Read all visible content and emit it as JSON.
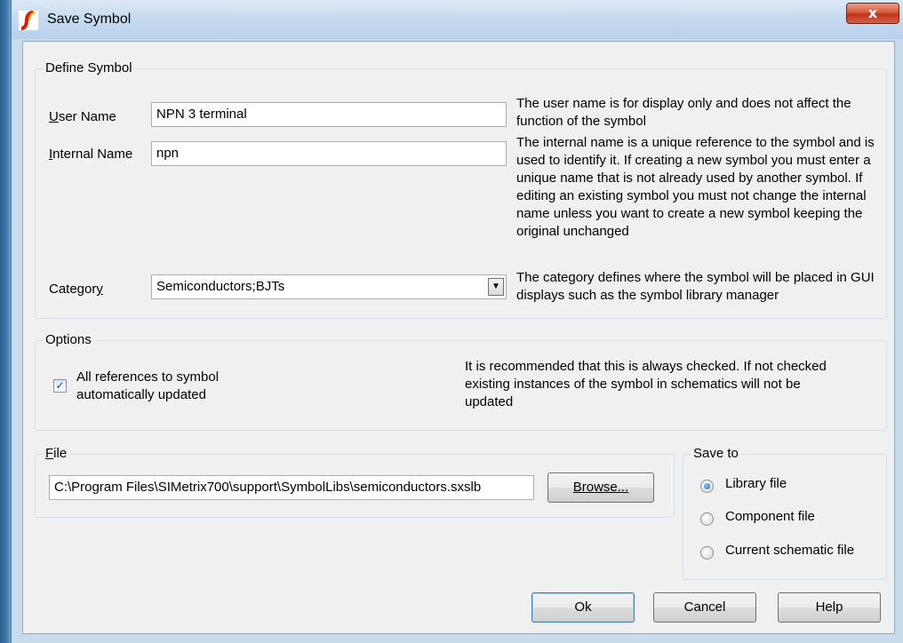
{
  "window": {
    "title": "Save Symbol",
    "close_label": "x"
  },
  "define_symbol": {
    "title": "Define Symbol",
    "user_name": {
      "label": "User Name",
      "value": "NPN 3 terminal",
      "help": "The user name is for display only and does not affect the function of the symbol"
    },
    "internal_name": {
      "label": "Internal Name",
      "value": "npn",
      "help": "The internal name is a unique reference to the symbol and is used to identify it. If creating a new symbol you must enter a unique name that is not already used by another symbol. If editing an existing symbol you must not change the internal name unless you want to create a new symbol keeping the original unchanged"
    },
    "category": {
      "label": "Category",
      "value": "Semiconductors;BJTs",
      "help": "The category defines where the symbol will be placed in GUI displays such as the symbol library manager"
    }
  },
  "options": {
    "title": "Options",
    "auto_update": {
      "label": "All references to symbol automatically updated",
      "checked": true
    },
    "help": "It is recommended that this is always checked. If not checked existing instances of the symbol in schematics will not be updated"
  },
  "file": {
    "title": "File",
    "path": "C:\\Program Files\\SIMetrix700\\support\\SymbolLibs\\semiconductors.sxslb",
    "browse_label": "Browse..."
  },
  "save_to": {
    "title": "Save to",
    "options": [
      {
        "label": "Library file",
        "checked": true
      },
      {
        "label": "Component file",
        "checked": false
      },
      {
        "label": "Current schematic file",
        "checked": false
      }
    ]
  },
  "buttons": {
    "ok": "Ok",
    "cancel": "Cancel",
    "help": "Help"
  }
}
